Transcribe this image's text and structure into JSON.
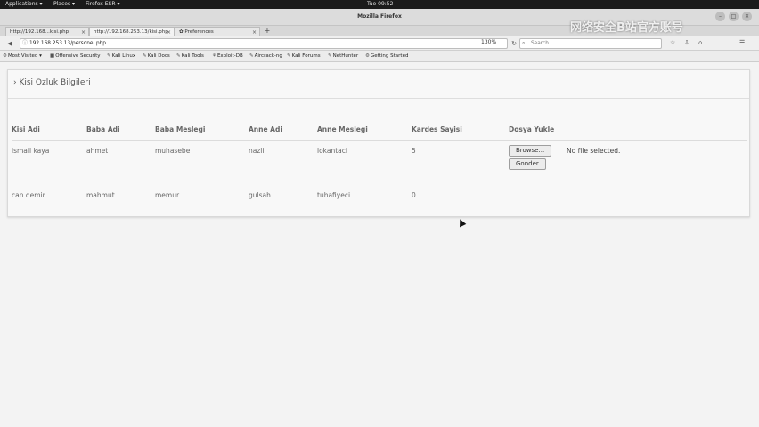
{
  "system_bar": {
    "applications": "Applications ▾",
    "places": "Places ▾",
    "browser": "Firefox ESR ▾",
    "clock": "Tue 09:52"
  },
  "window": {
    "title": "Mozilla Firefox",
    "minimize": "–",
    "maximize": "□",
    "close": "✕"
  },
  "tabs": [
    {
      "label": "http://192.168...kisi.php",
      "close": "×"
    },
    {
      "label": "http://192.168.253.13/kisi.php",
      "close": "×"
    },
    {
      "label": "✿ Preferences",
      "close": "×"
    }
  ],
  "new_tab": "+",
  "navbar": {
    "back": "◀",
    "reload": "↻",
    "url": "192.168.253.13/personel.php",
    "zoom": "130%",
    "search_placeholder": "Search",
    "search_icon": "search-icon",
    "right_icons": [
      "☆",
      "⇩",
      "⌂",
      "☰"
    ]
  },
  "bookmarks": [
    {
      "label": "Most Visited ▾",
      "icon": "⚙"
    },
    {
      "label": "Offensive Security",
      "icon": "■"
    },
    {
      "label": "Kali Linux",
      "icon": "✎"
    },
    {
      "label": "Kali Docs",
      "icon": "✎"
    },
    {
      "label": "Kali Tools",
      "icon": "✎"
    },
    {
      "label": "Exploit-DB",
      "icon": "⚘"
    },
    {
      "label": "Aircrack-ng",
      "icon": "✎"
    },
    {
      "label": "Kali Forums",
      "icon": "✎"
    },
    {
      "label": "NetHunter",
      "icon": "✎"
    },
    {
      "label": "Getting Started",
      "icon": "⚙"
    }
  ],
  "panel": {
    "title": "› Kisi Ozluk Bilgileri"
  },
  "table": {
    "headers": [
      "Kisi Adi",
      "Baba Adi",
      "Baba Meslegi",
      "Anne Adi",
      "Anne Meslegi",
      "Kardes Sayisi",
      "Dosya Yukle"
    ],
    "rows": [
      [
        "ismail kaya",
        "ahmet",
        "muhasebe",
        "nazli",
        "lokantaci",
        "5"
      ],
      [
        "can demir",
        "mahmut",
        "memur",
        "gulsah",
        "tuhafiyeci",
        "0"
      ]
    ],
    "browse_label": "Browse...",
    "no_file": "No file selected.",
    "submit_label": "Gonder"
  },
  "watermark": "网络安全B站官方账号"
}
